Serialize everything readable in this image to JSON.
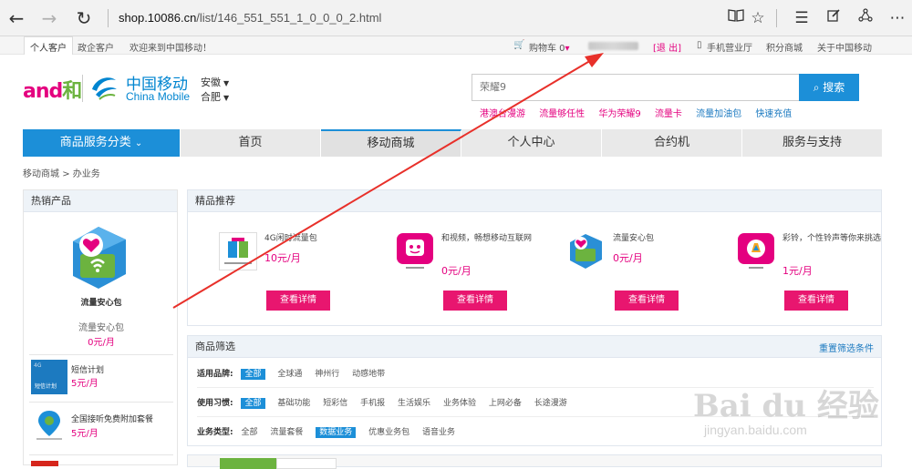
{
  "browser": {
    "url_host": "shop.10086.cn",
    "url_path": "/list/146_551_551_1_0_0_0_2.html"
  },
  "topbar": {
    "personal": "个人客户",
    "enterprise": "政企客户",
    "welcome": "欢迎来到中国移动！",
    "cart": "购物车 0",
    "logout": "[退 出]",
    "mobile_hall": "手机营业厅",
    "points_mall": "积分商城",
    "about": "关于中国移动"
  },
  "header": {
    "logo_and": "and",
    "logo_he": "和",
    "logo_cn": "中国移动",
    "logo_en": "China Mobile",
    "province": "安徽",
    "city": "合肥",
    "search_placeholder": "荣耀9",
    "search_button": "搜索",
    "hot_words": [
      "港澳台漫游",
      "流量够任性",
      "华为荣耀9",
      "流量卡",
      "流量加油包",
      "快速充值"
    ]
  },
  "nav": {
    "category": "商品服务分类",
    "items": [
      "首页",
      "移动商城",
      "个人中心",
      "合约机",
      "服务与支持"
    ]
  },
  "breadcrumb": {
    "home": "移动商城",
    "current": "办业务"
  },
  "sidebar": {
    "title": "热销产品",
    "hero": {
      "icon_caption": "流量安心包",
      "name": "流量安心包",
      "price": "0元/月"
    },
    "items": [
      {
        "title": "短信计划",
        "price": "5元/月",
        "thumb_text": "短信计划"
      },
      {
        "title": "全国接听免费附加套餐",
        "price": "5元/月"
      }
    ]
  },
  "featured": {
    "title": "精品推荐",
    "cards": [
      {
        "desc": "4G闲时流量包",
        "price": "10元/月",
        "button": "查看详情",
        "thumb_caption": "4G闲时流量包"
      },
      {
        "desc": "和视频，畅想移动互联网",
        "price": "0元/月",
        "button": "查看详情",
        "thumb_caption": "和视频"
      },
      {
        "desc": "流量安心包",
        "price": "0元/月",
        "button": "查看详情",
        "thumb_caption": "流量安心包"
      },
      {
        "desc": "彩铃，个性铃声等你来挑选",
        "price": "1元/月",
        "button": "查看详情",
        "thumb_caption": "彩铃"
      }
    ]
  },
  "filter": {
    "title": "商品筛选",
    "reset": "重置筛选条件",
    "rows": [
      {
        "label": "适用品牌:",
        "options": [
          "全部",
          "全球通",
          "神州行",
          "动感地带"
        ],
        "selected": 0
      },
      {
        "label": "使用习惯:",
        "options": [
          "全部",
          "基础功能",
          "短彩信",
          "手机报",
          "生活娱乐",
          "业务体验",
          "上网必备",
          "长途漫游"
        ],
        "selected": 0
      },
      {
        "label": "业务类型:",
        "options": [
          "全部",
          "流量套餐",
          "数据业务",
          "优惠业务包",
          "语音业务"
        ],
        "selected": 2
      }
    ]
  },
  "watermark": {
    "text": "Bai du 经验",
    "url": "jingyan.baidu.com"
  },
  "colors": {
    "brand_blue": "#1c8fd8",
    "brand_pink": "#e4007f",
    "button_pink": "#e8166f",
    "annotation_red": "#e8302a"
  }
}
